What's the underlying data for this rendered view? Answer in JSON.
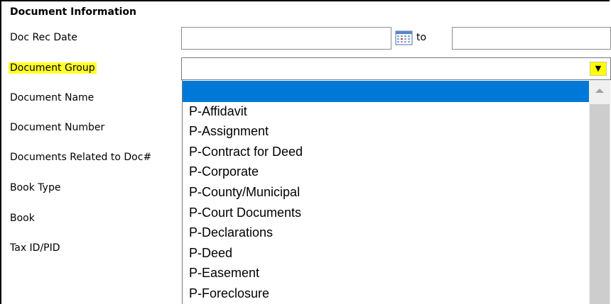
{
  "form": {
    "section_title": "Document Information",
    "labels": {
      "doc_rec_date": "Doc Rec Date",
      "document_group": "Document Group",
      "document_name": "Document Name",
      "document_number": "Document Number",
      "documents_related": "Documents Related to Doc#",
      "book_type": "Book Type",
      "book": "Book",
      "tax_id": "Tax ID/PID"
    },
    "doc_rec_date": {
      "from_value": "",
      "to_label": "to",
      "to_value": ""
    },
    "document_group": {
      "value": "",
      "arrow": "▼"
    },
    "dropdown": {
      "options": [
        "",
        "P-Affidavit",
        "P-Assignment",
        "P-Contract for Deed",
        "P-Corporate",
        "P-County/Municipal",
        "P-Court Documents",
        "P-Declarations",
        "P-Deed",
        "P-Easement",
        "P-Foreclosure"
      ],
      "selected_index": 0
    }
  },
  "colors": {
    "highlight": "#ffff2a",
    "selection": "#0078d7",
    "arrow_bg": "#ffff00"
  },
  "icons": {
    "calendar": "calendar-icon",
    "dropdown_arrow": "dropdown-arrow-icon",
    "scroll_up": "scroll-up-icon"
  }
}
